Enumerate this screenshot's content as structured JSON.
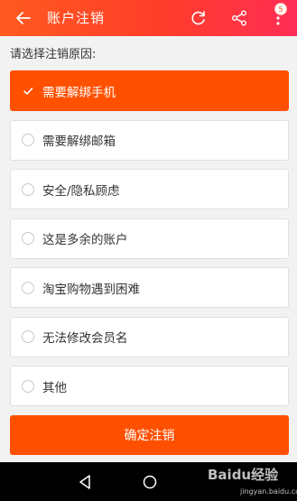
{
  "header": {
    "title": "账户注销",
    "back_icon": "back-arrow-icon",
    "refresh_icon": "refresh-icon",
    "share_icon": "share-icon",
    "more_icon": "more-vertical-icon",
    "badge_count": "5"
  },
  "prompt": "请选择注销原因:",
  "options": [
    {
      "label": "需要解绑手机",
      "selected": true
    },
    {
      "label": "需要解绑邮箱",
      "selected": false
    },
    {
      "label": "安全/隐私顾虑",
      "selected": false
    },
    {
      "label": "这是多余的账户",
      "selected": false
    },
    {
      "label": "淘宝购物遇到困难",
      "selected": false
    },
    {
      "label": "无法修改会员名",
      "selected": false
    },
    {
      "label": "其他",
      "selected": false
    }
  ],
  "confirm_label": "确定注销",
  "navbar": {
    "back_icon": "nav-back-icon",
    "home_icon": "nav-home-icon"
  },
  "watermark": {
    "main": "Baidu经验",
    "sub": "jingyan.baidu.com"
  },
  "colors": {
    "accent": "#ff5000",
    "header_gradient_end": "#ff2d55"
  }
}
